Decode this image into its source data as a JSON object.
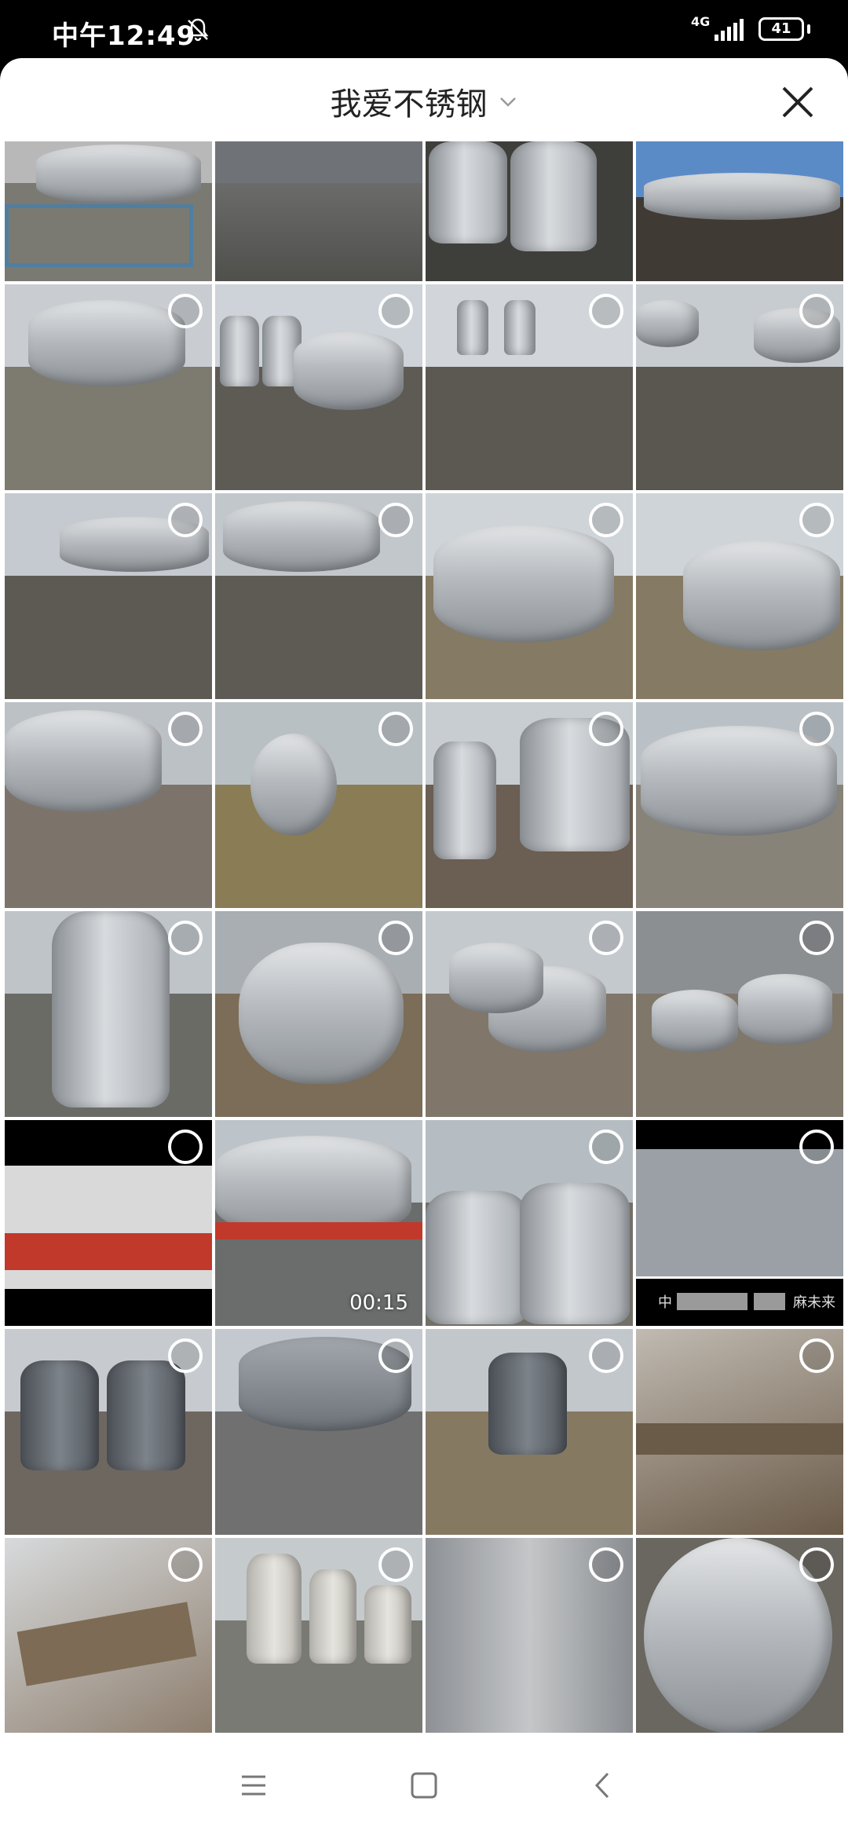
{
  "status": {
    "time": "中午12:49",
    "network": "4G",
    "battery": "41"
  },
  "header": {
    "album_title": "我爱不锈钢"
  },
  "icons": {
    "dnd": "do-not-disturb-icon",
    "signal": "signal-icon",
    "battery": "battery-icon",
    "chevron": "chevron-down-icon",
    "close": "close-icon",
    "menu": "menu-icon",
    "home": "home-icon",
    "back": "back-icon"
  },
  "grid": {
    "video_duration": "00:15",
    "caption_left": "中",
    "caption_right": "麻未来"
  }
}
